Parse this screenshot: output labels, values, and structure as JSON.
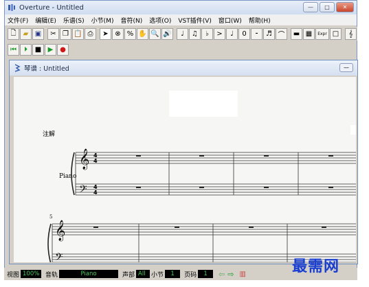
{
  "window": {
    "title": "Overture - Untitled"
  },
  "menu": [
    "文件(F)",
    "编辑(E)",
    "乐谱(S)",
    "小节(M)",
    "音符(N)",
    "选项(O)",
    "VST插件(V)",
    "窗口(W)",
    "帮助(H)"
  ],
  "toolbar": {
    "zero_label": "0",
    "expr_label": "Expr"
  },
  "document": {
    "title": "琴谱 : Untitled",
    "annotation_label": "注解",
    "instrument_label": "Piano",
    "measure_number": "5",
    "time_signature_top": "4",
    "time_signature_bottom": "4"
  },
  "status": {
    "view_label": "视图",
    "zoom_value": "100%",
    "track_label": "音轨",
    "track_value": "Piano",
    "voice_label": "声部",
    "voice_value": "All",
    "measure_label": "小节",
    "measure_value": "1",
    "page_label": "页码",
    "page_value": "1"
  },
  "watermark": "最需网",
  "colors": {
    "accent": "#1a3ed0",
    "status_text": "#4fc85a",
    "play_green": "#1a9a2a",
    "record_red": "#d01818"
  }
}
